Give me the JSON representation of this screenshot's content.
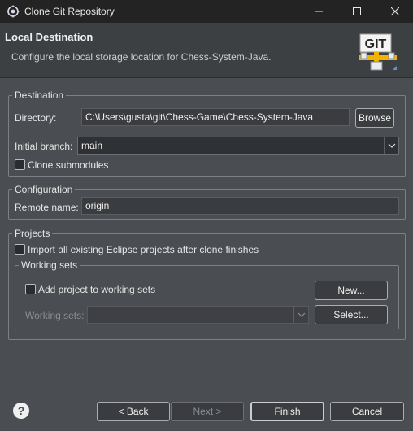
{
  "window": {
    "title": "Clone Git Repository",
    "icon": "eclipse-icon"
  },
  "banner": {
    "heading": "Local Destination",
    "description": "Configure the local storage location for Chess-System-Java.",
    "logo_text": "GIT"
  },
  "destination": {
    "legend": "Destination",
    "directory_label": "Directory:",
    "directory_value": "C:\\Users\\gusta\\git\\Chess-Game\\Chess-System-Java",
    "browse_label": "Browse",
    "branch_label": "Initial branch:",
    "branch_value": "main",
    "clone_submodules_label": "Clone submodules",
    "clone_submodules_checked": false
  },
  "configuration": {
    "legend": "Configuration",
    "remote_label": "Remote name:",
    "remote_value": "origin"
  },
  "projects": {
    "legend": "Projects",
    "import_label": "Import all existing Eclipse projects after clone finishes",
    "import_checked": false,
    "working_sets_legend": "Working sets",
    "add_label": "Add project to working sets",
    "add_checked": false,
    "new_label": "New...",
    "working_sets_label": "Working sets:",
    "working_sets_value": "",
    "select_label": "Select..."
  },
  "footer": {
    "back_label": "< Back",
    "next_label": "Next >",
    "finish_label": "Finish",
    "cancel_label": "Cancel"
  },
  "colors": {
    "background": "#4a4d51",
    "titlebar": "#232323",
    "banner": "#3d4043",
    "text": "#e6e6e6"
  }
}
